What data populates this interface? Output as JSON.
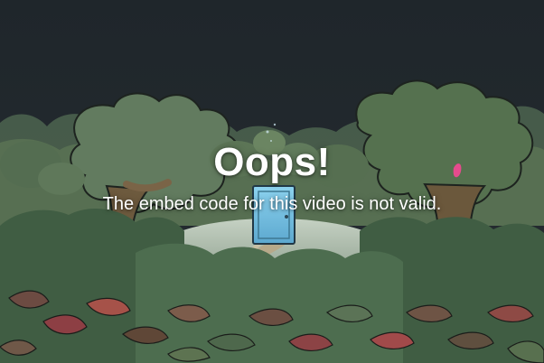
{
  "error": {
    "title": "Oops!",
    "message": "The embed code for this video is not valid."
  },
  "scene": {
    "icon": "forest-door-illustration",
    "sky_color": "#1f262b",
    "door_color": "#6fb6d8",
    "foliage_color": "#4f6a4b",
    "trunk_color": "#6d5a3e",
    "path_color": "#b7a98a",
    "glow_color": "#e54b8d"
  }
}
